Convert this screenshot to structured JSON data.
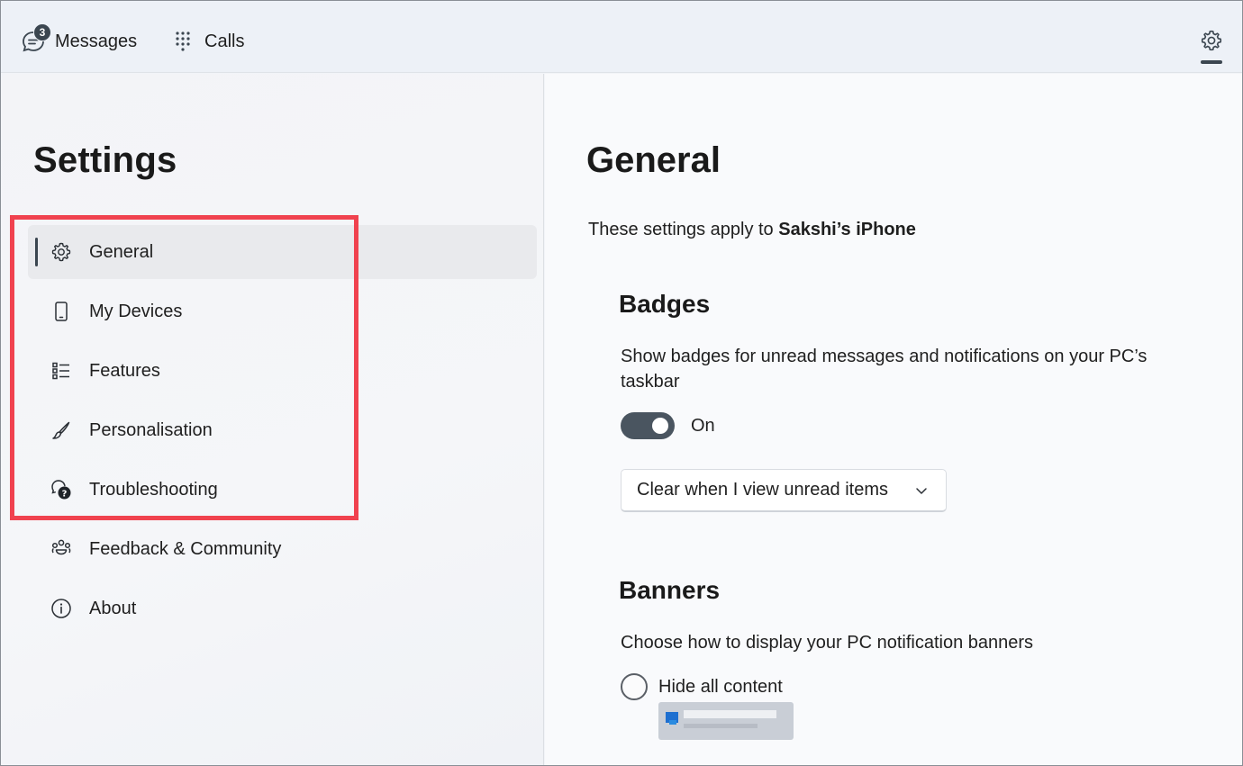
{
  "topbar": {
    "tabs": [
      {
        "label": "Messages",
        "icon": "chat-icon",
        "badge": "3"
      },
      {
        "label": "Calls",
        "icon": "dialpad-icon"
      }
    ],
    "settings_icon": "gear-icon"
  },
  "sidebar": {
    "title": "Settings",
    "items": [
      {
        "label": "General",
        "icon": "gear-icon",
        "selected": true
      },
      {
        "label": "My Devices",
        "icon": "phone-icon"
      },
      {
        "label": "Features",
        "icon": "list-icon"
      },
      {
        "label": "Personalisation",
        "icon": "brush-icon"
      },
      {
        "label": "Troubleshooting",
        "icon": "troubleshoot-icon"
      },
      {
        "label": "Feedback & Community",
        "icon": "community-icon"
      },
      {
        "label": "About",
        "icon": "info-icon"
      }
    ],
    "highlight_color": "#f0424f"
  },
  "main": {
    "title": "General",
    "applies_prefix": "These settings apply to ",
    "device_name": "Sakshi’s iPhone",
    "badges": {
      "title": "Badges",
      "description": "Show badges for unread messages and notifications on your PC’s taskbar",
      "toggle_state": "On",
      "toggle_on": true,
      "dropdown_value": "Clear when I view unread items"
    },
    "banners": {
      "title": "Banners",
      "description": "Choose how to display your PC notification banners",
      "option_hide": "Hide all content",
      "option_hide_selected": false
    }
  },
  "colors": {
    "accent": "#3b4650",
    "toggle_bg": "#4a5560"
  }
}
